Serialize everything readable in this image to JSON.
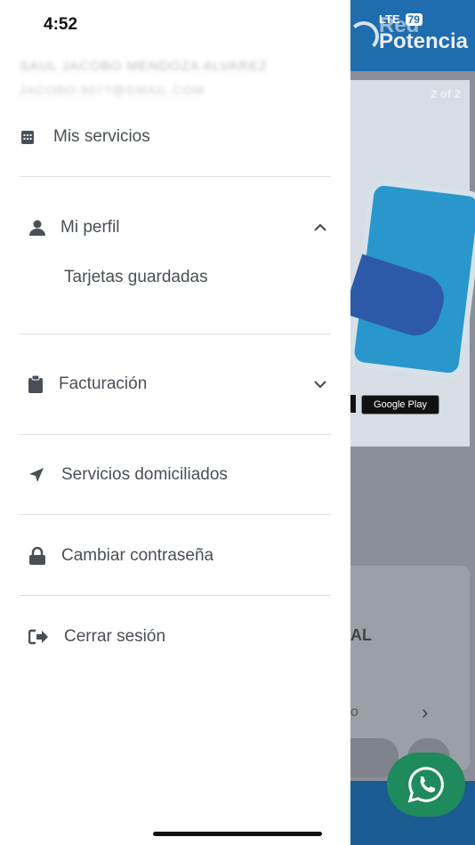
{
  "status_bar": {
    "time": "4:52",
    "network": "LTE",
    "battery": "79"
  },
  "background": {
    "brand_top": "Red",
    "brand_bottom": "Potencia",
    "carousel_counter": "2 of 2",
    "store_badge": "Google Play",
    "card_text": "AL",
    "card_text2": "o"
  },
  "user": {
    "name": "SAUL JACOBO MENDOZA ALVAREZ",
    "email": "JACOBO.907?@GMAIL.COM"
  },
  "menu": {
    "mis_servicios": "Mis servicios",
    "mi_perfil": "Mi perfil",
    "tarjetas_guardadas": "Tarjetas guardadas",
    "facturacion": "Facturación",
    "servicios_domiciliados": "Servicios domiciliados",
    "cambiar_contrasena": "Cambiar contraseña",
    "cerrar_sesion": "Cerrar sesión"
  },
  "colors": {
    "header_blue": "#1f6cae",
    "whatsapp_green": "#1f8a5c",
    "text_gray": "#4a4f57"
  },
  "icons": [
    "calendar-icon",
    "user-icon",
    "chevron-up-icon",
    "clipboard-icon",
    "chevron-down-icon",
    "location-arrow-icon",
    "lock-icon",
    "sign-out-icon",
    "whatsapp-icon"
  ]
}
